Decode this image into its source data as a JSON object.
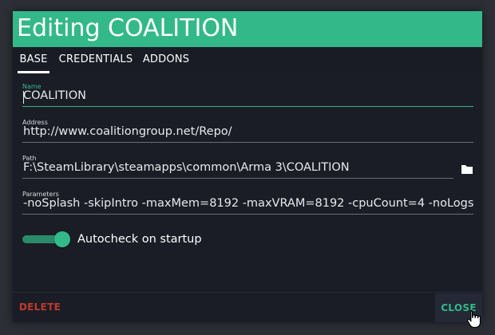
{
  "dialog": {
    "title": "Editing COALITION"
  },
  "tabs": [
    {
      "label": "BASE",
      "active": true
    },
    {
      "label": "CREDENTIALS",
      "active": false
    },
    {
      "label": "ADDONS",
      "active": false
    }
  ],
  "fields": {
    "name": {
      "label": "Name",
      "value": "COALITION"
    },
    "address": {
      "label": "Address",
      "value": "http://www.coalitiongroup.net/Repo/"
    },
    "path": {
      "label": "Path",
      "value": "F:\\SteamLibrary\\steamapps\\common\\Arma 3\\COALITION",
      "icon": "folder-icon"
    },
    "parameters": {
      "label": "Parameters",
      "value": "-noSplash -skipIntro -maxMem=8192 -maxVRAM=8192 -cpuCount=4 -noLogs -"
    }
  },
  "autocheck": {
    "label": "Autocheck on startup",
    "enabled": true
  },
  "footer": {
    "delete_label": "DELETE",
    "close_label": "CLOSE"
  },
  "colors": {
    "accent": "#33b889",
    "danger": "#c0392b",
    "background": "#1a1d26"
  }
}
